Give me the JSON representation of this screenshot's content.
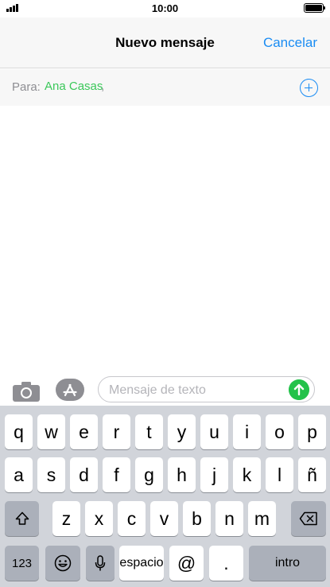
{
  "status_bar": {
    "time": "10:00"
  },
  "header": {
    "title": "Nuevo mensaje",
    "cancel_label": "Cancelar"
  },
  "recipient": {
    "label": "Para:",
    "name": "Ana Casas",
    "separator": ","
  },
  "compose": {
    "placeholder": "Mensaje de texto"
  },
  "keyboard": {
    "row1": [
      "q",
      "w",
      "e",
      "r",
      "t",
      "y",
      "u",
      "i",
      "o",
      "p"
    ],
    "row2": [
      "a",
      "s",
      "d",
      "f",
      "g",
      "h",
      "j",
      "k",
      "l",
      "ñ"
    ],
    "row3": [
      "z",
      "x",
      "c",
      "v",
      "b",
      "n",
      "m"
    ],
    "numbers_label": "123",
    "space_label": "espacio",
    "at_label": "@",
    "period_label": ".",
    "return_label": "intro"
  },
  "colors": {
    "accent": "#1a8cf3",
    "recipient_green": "#3bc85a",
    "send_green": "#23c24a"
  },
  "icons": [
    "signal-icon",
    "battery-icon",
    "add-contact-icon",
    "camera-icon",
    "app-store-icon",
    "send-arrow-icon",
    "shift-icon",
    "delete-icon",
    "emoji-icon",
    "microphone-icon"
  ]
}
